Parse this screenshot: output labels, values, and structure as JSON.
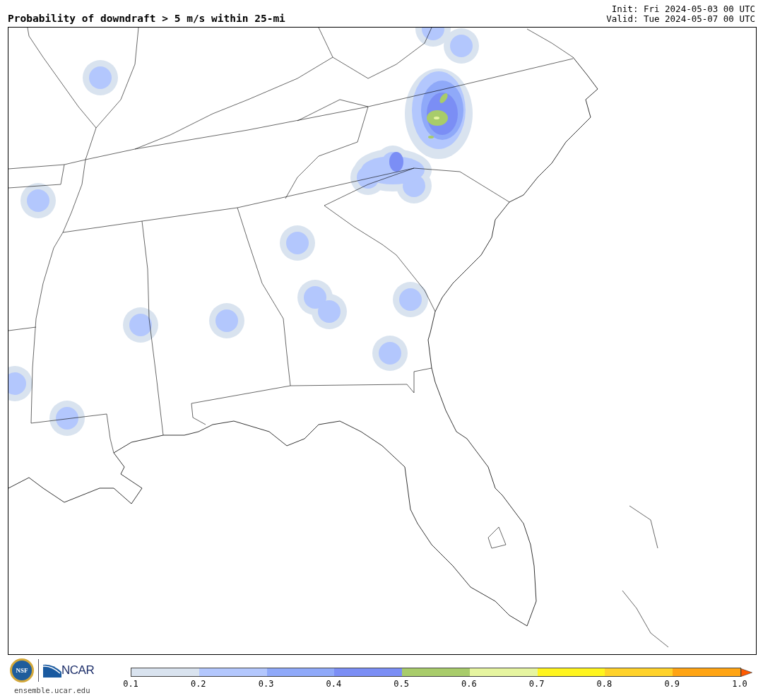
{
  "title": "Probability of downdraft > 5 m/s within 25-mi",
  "init": "Init: Fri 2024-05-03 00 UTC",
  "valid": "Valid: Tue 2024-05-07 00 UTC",
  "footer": {
    "nsf_logo_text": "NSF",
    "ncar_logo_text": "NCAR",
    "url": "ensemble.ucar.edu"
  },
  "colorbar": {
    "bins": [
      {
        "kind": "bin",
        "color": "#d9e3ef"
      },
      {
        "kind": "bin",
        "color": "#b3c7fd"
      },
      {
        "kind": "bin",
        "color": "#8fa9f9"
      },
      {
        "kind": "bin",
        "color": "#7b8ef5"
      },
      {
        "kind": "bin",
        "color": "#a8cc6a"
      },
      {
        "kind": "bin",
        "color": "#e6f5a0"
      },
      {
        "kind": "bin",
        "color": "#fff51e"
      },
      {
        "kind": "bin",
        "color": "#ffd22a"
      },
      {
        "kind": "bin",
        "color": "#ffa414"
      },
      {
        "kind": "arrow",
        "color": "#ff5a00"
      }
    ],
    "ticks": [
      "0.1",
      "0.2",
      "0.3",
      "0.4",
      "0.5",
      "0.6",
      "0.7",
      "0.8",
      "0.9",
      "1.0"
    ]
  }
}
